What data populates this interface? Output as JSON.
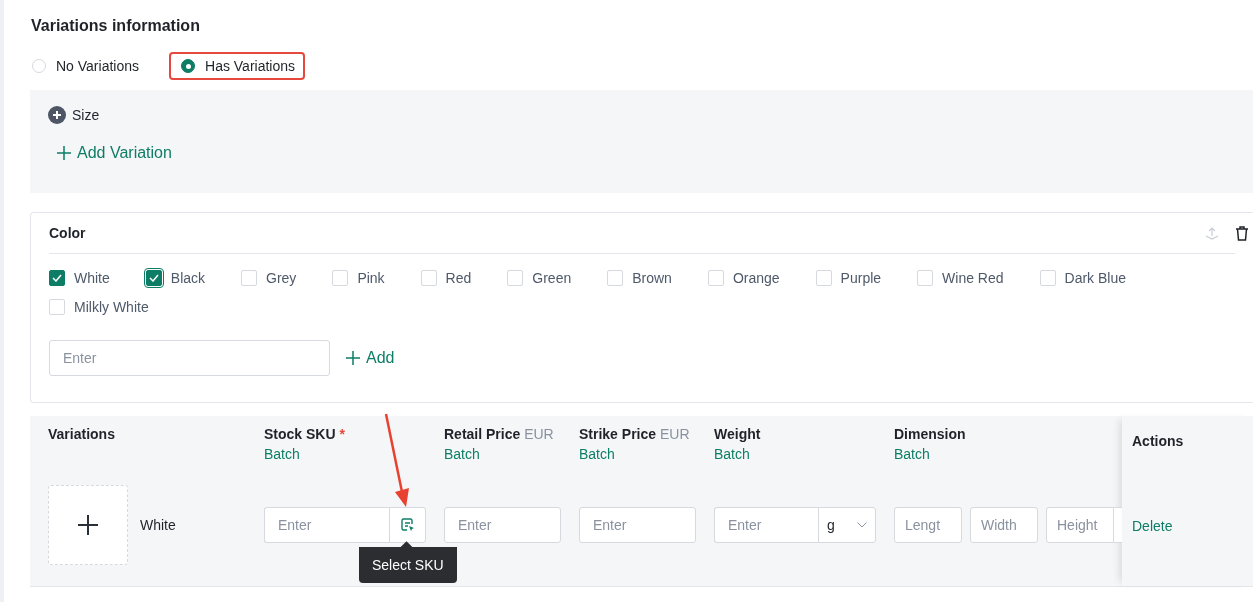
{
  "section_title": "Variations information",
  "variation_mode": [
    {
      "label": "No Variations",
      "selected": false,
      "highlighted": false
    },
    {
      "label": "Has Variations",
      "selected": true,
      "highlighted": true
    }
  ],
  "size_panel": {
    "name": "Size",
    "add_button": "Add Variation"
  },
  "color_card": {
    "title": "Color",
    "options": [
      {
        "label": "White",
        "checked": true,
        "focused": false
      },
      {
        "label": "Black",
        "checked": true,
        "focused": true
      },
      {
        "label": "Grey",
        "checked": false,
        "focused": false
      },
      {
        "label": "Pink",
        "checked": false,
        "focused": false
      },
      {
        "label": "Red",
        "checked": false,
        "focused": false
      },
      {
        "label": "Green",
        "checked": false,
        "focused": false
      },
      {
        "label": "Brown",
        "checked": false,
        "focused": false
      },
      {
        "label": "Orange",
        "checked": false,
        "focused": false
      },
      {
        "label": "Purple",
        "checked": false,
        "focused": false
      },
      {
        "label": "Wine Red",
        "checked": false,
        "focused": false
      },
      {
        "label": "Dark Blue",
        "checked": false,
        "focused": false
      },
      {
        "label": "Milkly White",
        "checked": false,
        "focused": false
      }
    ],
    "input_placeholder": "Enter",
    "add_button": "Add"
  },
  "table": {
    "columns": [
      {
        "title": "Variations"
      },
      {
        "title": "Stock SKU",
        "required_mark": "*",
        "batch": "Batch"
      },
      {
        "title": "Retail Price",
        "unit": "EUR",
        "batch": "Batch"
      },
      {
        "title": "Strike Price",
        "unit": "EUR",
        "batch": "Batch"
      },
      {
        "title": "Weight",
        "batch": "Batch"
      },
      {
        "title": "Dimension",
        "batch": "Batch"
      }
    ],
    "actions_title": "Actions",
    "rows": [
      {
        "name": "White",
        "sku_placeholder": "Enter",
        "retail_placeholder": "Enter",
        "strike_placeholder": "Enter",
        "weight_placeholder": "Enter",
        "weight_unit": "g",
        "length_placeholder": "Lengt",
        "width_placeholder": "Width",
        "height_placeholder": "Height",
        "action": "Delete"
      }
    ]
  },
  "tooltip": "Select SKU"
}
